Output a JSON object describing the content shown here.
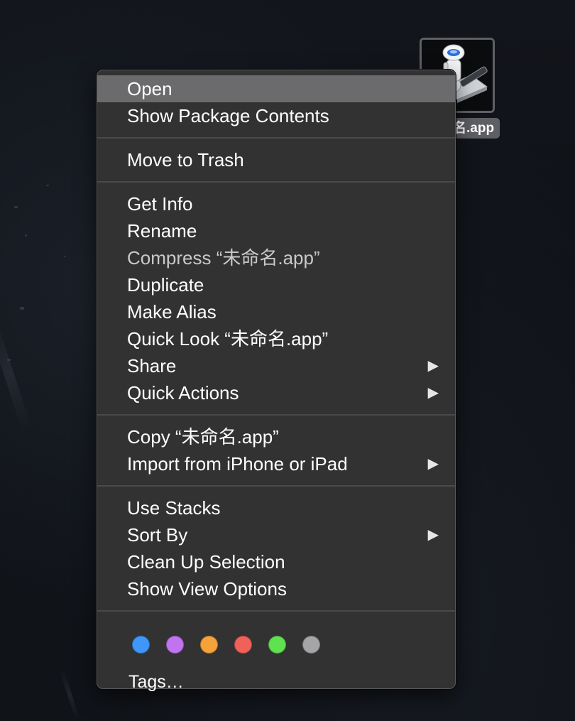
{
  "desktop": {
    "app_label": "未命名.app",
    "app_icon": "automator-robot-icon"
  },
  "menu": {
    "groups": [
      [
        {
          "label": "Open",
          "highlighted": true
        },
        {
          "label": "Show Package Contents"
        }
      ],
      [
        {
          "label": "Move to Trash"
        }
      ],
      [
        {
          "label": "Get Info"
        },
        {
          "label": "Rename"
        },
        {
          "label": "Compress “未命名.app”",
          "disabled": true
        },
        {
          "label": "Duplicate"
        },
        {
          "label": "Make Alias"
        },
        {
          "label": "Quick Look “未命名.app”"
        },
        {
          "label": "Share",
          "submenu": true
        },
        {
          "label": "Quick Actions",
          "submenu": true
        }
      ],
      [
        {
          "label": "Copy “未命名.app”"
        },
        {
          "label": "Import from iPhone or iPad",
          "submenu": true
        }
      ],
      [
        {
          "label": "Use Stacks"
        },
        {
          "label": "Sort By",
          "submenu": true
        },
        {
          "label": "Clean Up Selection"
        },
        {
          "label": "Show View Options"
        }
      ]
    ],
    "submenu_arrow": "▶",
    "tag_colors": [
      {
        "name": "blue",
        "color": "#3f97f7"
      },
      {
        "name": "purple",
        "color": "#c074f0"
      },
      {
        "name": "orange",
        "color": "#f5a23a"
      },
      {
        "name": "red",
        "color": "#f0615a"
      },
      {
        "name": "green",
        "color": "#5ee24f"
      },
      {
        "name": "gray",
        "color": "#a5a5a8"
      }
    ],
    "tags_label": "Tags…"
  }
}
